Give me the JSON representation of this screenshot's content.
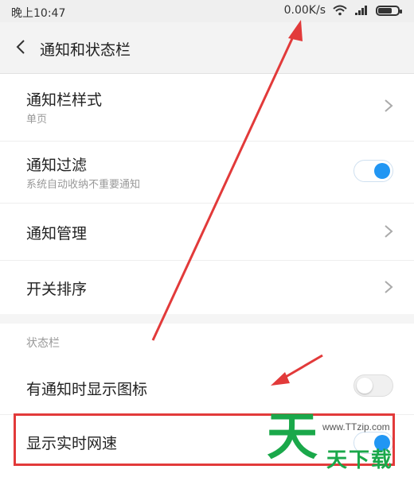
{
  "status_bar": {
    "time": "晚上10:47",
    "net_speed": "0.00K/s",
    "wifi_icon": "wifi-icon",
    "signal_icon": "signal-icon",
    "battery_icon": "battery-icon",
    "battery_level": 0.75
  },
  "header": {
    "back_icon": "chevron-left-icon",
    "title": "通知和状态栏"
  },
  "notification_section": {
    "items": [
      {
        "title": "通知栏样式",
        "subtitle": "单页",
        "control": "chevron"
      },
      {
        "title": "通知过滤",
        "subtitle": "系统自动收纳不重要通知",
        "control": "toggle",
        "toggle_on": true
      },
      {
        "title": "通知管理",
        "control": "chevron"
      },
      {
        "title": "开关排序",
        "control": "chevron"
      }
    ]
  },
  "status_bar_section": {
    "header": "状态栏",
    "items": [
      {
        "title": "有通知时显示图标",
        "control": "toggle",
        "toggle_on": false
      },
      {
        "title": "显示实时网速",
        "control": "toggle",
        "toggle_on": true
      }
    ]
  },
  "watermark": {
    "logo_char": "天",
    "url": "www.TTzip.com",
    "text": "天下载"
  },
  "colors": {
    "accent": "#2196f3",
    "annotation_red": "#e23a3a",
    "watermark_green": "#1aa84a"
  }
}
